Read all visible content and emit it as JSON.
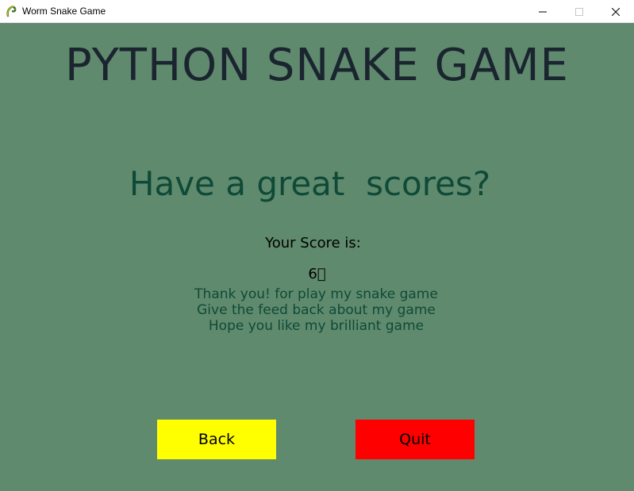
{
  "window": {
    "title": "Worm Snake Game",
    "icon": "pygame-snake-icon",
    "controls": [
      "minimize-icon",
      "maximize-icon",
      "close-icon"
    ]
  },
  "game": {
    "title": "PYTHON SNAKE GAME",
    "headline": "Have a great  scores?",
    "score_label": "Your Score is:",
    "score_value": "6\u0000",
    "messages": [
      "Thank you! for play my snake game",
      "Give the feed back about my game",
      "Hope you like my brilliant game"
    ],
    "buttons": {
      "back_label": "Back",
      "quit_label": "Quit"
    }
  },
  "colors": {
    "background": "#5f8a6d",
    "title": "#1b2530",
    "headline": "#0f4a38",
    "back_button": "#ffff00",
    "quit_button": "#ff0000"
  }
}
